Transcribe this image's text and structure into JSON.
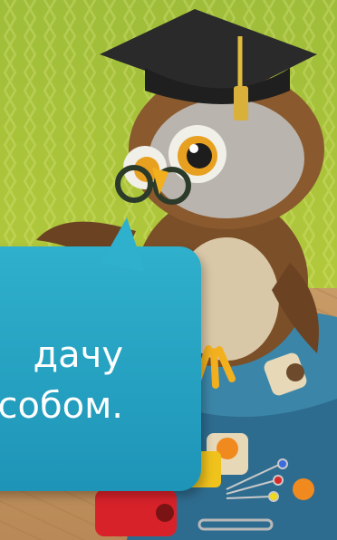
{
  "speech_bubble": {
    "line1": "дачу",
    "line2": "собом."
  },
  "colors": {
    "background": "#a8c13a",
    "bubble": "#2aa7c6",
    "table": "#c79a66",
    "owl_body": "#8a5a2e",
    "cap": "#2a2a2a",
    "tassel": "#d8b03a"
  },
  "illustration": {
    "character": "owl-professor",
    "items": [
      "graduation-cap",
      "glasses",
      "thread-spools",
      "pins",
      "safety-pin",
      "buttons"
    ]
  }
}
